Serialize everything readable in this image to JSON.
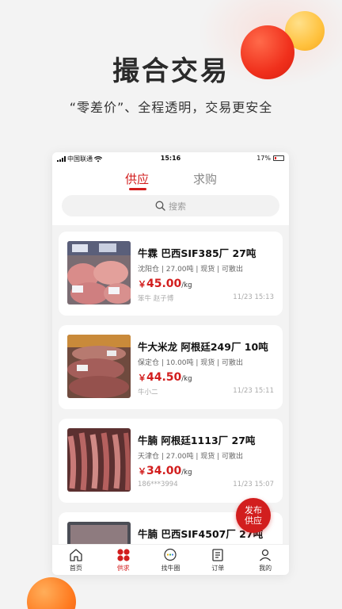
{
  "hero": {
    "title": "撮合交易",
    "subtitle": "“零差价”、全程透明，交易更安全"
  },
  "status_bar": {
    "carrier": "中国联通",
    "time": "15:16",
    "battery": "17%"
  },
  "tabs": [
    {
      "label": "供应",
      "active": true
    },
    {
      "label": "求购",
      "active": false
    }
  ],
  "search": {
    "placeholder": "搜索",
    "icon": "search-icon"
  },
  "listings": [
    {
      "title": "牛霖 巴西SIF385厂 27吨",
      "meta": "沈阳仓 | 27.00吨 | 现货 | 可散出",
      "currency": "￥",
      "price": "45.00",
      "unit": "/kg",
      "seller": "笨牛 赵子博",
      "time": "11/23 15:13"
    },
    {
      "title": "牛大米龙 阿根廷249厂 10吨",
      "meta": "保定仓 | 10.00吨 | 现货 | 可散出",
      "currency": "￥",
      "price": "44.50",
      "unit": "/kg",
      "seller": "牛小二",
      "time": "11/23 15:11"
    },
    {
      "title": "牛腩 阿根廷1113厂 27吨",
      "meta": "天津仓 | 27.00吨 | 现货 | 可散出",
      "currency": "￥",
      "price": "34.00",
      "unit": "/kg",
      "seller": "186***3994",
      "time": "11/23 15:07"
    },
    {
      "title": "牛腩 巴西SIF4507厂 27吨",
      "meta": "",
      "currency": "",
      "price": "",
      "unit": "",
      "seller": "",
      "time": ""
    }
  ],
  "fab": {
    "line1": "发布",
    "line2": "供应"
  },
  "tabbar": [
    {
      "label": "首页",
      "icon": "home-icon",
      "active": false
    },
    {
      "label": "供求",
      "icon": "supply-demand-icon",
      "active": true
    },
    {
      "label": "找牛圈",
      "icon": "circle-chat-icon",
      "active": false
    },
    {
      "label": "订单",
      "icon": "order-icon",
      "active": false
    },
    {
      "label": "我的",
      "icon": "profile-icon",
      "active": false
    }
  ],
  "colors": {
    "accent": "#d21e1e",
    "background": "#f3f3f3"
  }
}
